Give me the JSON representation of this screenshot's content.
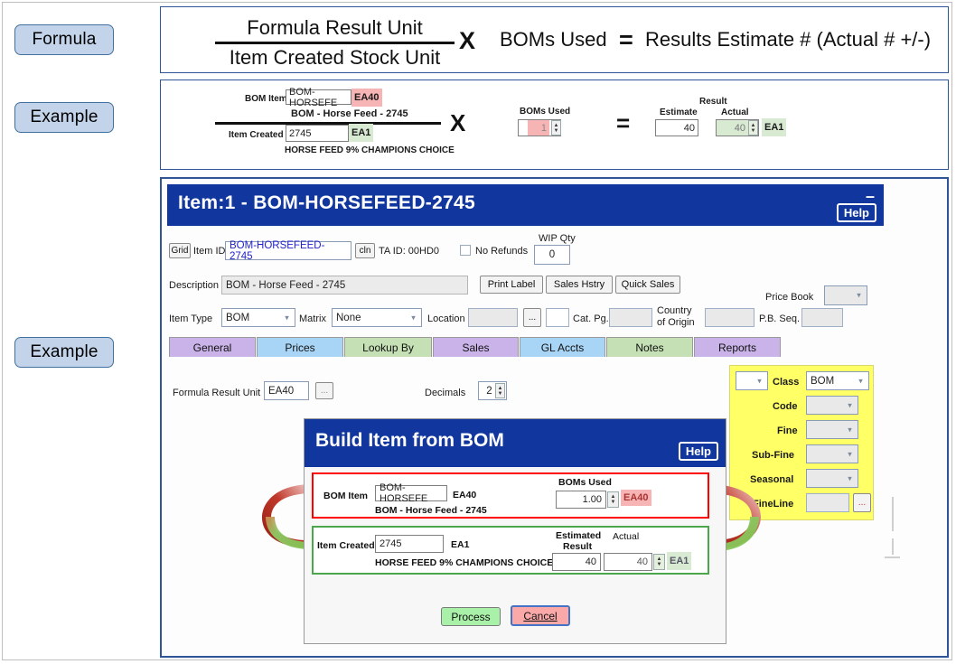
{
  "labels": {
    "formula": "Formula",
    "example_top": "Example",
    "example_bottom": "Example"
  },
  "formula": {
    "numerator": "Formula Result Unit",
    "denominator": "Item Created Stock Unit",
    "multiply_symbol": "X",
    "factor": "BOMs Used",
    "equals_symbol": "=",
    "result": "Results Estimate # (Actual # +/-)"
  },
  "example": {
    "bom_item_label": "BOM Item",
    "bom_item_value": "BOM-HORSEFE",
    "bom_item_unit": "EA40",
    "bom_description": "BOM - Horse Feed - 2745",
    "item_created_label": "Item Created",
    "item_created_value": "2745",
    "item_created_unit": "EA1",
    "item_description": "HORSE FEED 9% CHAMPIONS CHOICE",
    "multiply_symbol": "X",
    "boms_used_label": "BOMs Used",
    "boms_used_value": "1",
    "equals_symbol": "=",
    "result_label": "Result",
    "estimate_label": "Estimate",
    "estimate_value": "40",
    "actual_label": "Actual",
    "actual_value": "40",
    "actual_unit": "EA1"
  },
  "app": {
    "title": "Item:1 - BOM-HORSEFEED-2745",
    "minimize": "–",
    "help": "Help",
    "grid_button": "Grid",
    "item_id_label": "Item ID",
    "item_id_value": "BOM-HORSEFEED-2745",
    "cln_button": "cln",
    "ta_id": "TA ID: 00HD0",
    "no_refunds_label": "No Refunds",
    "wip_qty_label": "WIP Qty",
    "wip_qty_value": "0",
    "description_label": "Description",
    "description_value": "BOM - Horse Feed - 2745",
    "print_label_button": "Print Label",
    "sales_hstry_button": "Sales Hstry",
    "quick_sales_button": "Quick Sales",
    "price_book_label": "Price Book",
    "item_type_label": "Item Type",
    "item_type_value": "BOM",
    "matrix_label": "Matrix",
    "matrix_value": "None",
    "location_label": "Location",
    "ellipsis_button": "...",
    "cat_pg_label": "Cat. Pg.",
    "country_of_origin_label_1": "Country",
    "country_of_origin_label_2": "of Origin",
    "pb_seq_label": "P.B. Seq.",
    "tabs": [
      {
        "label": "General",
        "color": "purple"
      },
      {
        "label": "Prices",
        "color": "blue"
      },
      {
        "label": "Lookup By",
        "color": "green"
      },
      {
        "label": "Sales",
        "color": "purple"
      },
      {
        "label": "GL Accts",
        "color": "blue"
      },
      {
        "label": "Notes",
        "color": "green"
      },
      {
        "label": "Reports",
        "color": "purple"
      }
    ],
    "formula_result_unit_label": "Formula Result Unit",
    "formula_result_unit_value": "EA40",
    "formula_ellipsis": "...",
    "decimals_label": "Decimals",
    "decimals_value": "2"
  },
  "classpanel": {
    "class_label": "Class",
    "class_value": "BOM",
    "code_label": "Code",
    "fine_label": "Fine",
    "subfine_label": "Sub-Fine",
    "seasonal_label": "Seasonal",
    "fineline_label": "FineLine",
    "fineline_ellipsis": "...",
    "background": "#ffff66"
  },
  "dialog": {
    "title": "Build Item from BOM",
    "help": "Help",
    "bom_item_label": "BOM Item",
    "bom_item_value": "BOM-HORSEFE",
    "bom_item_unit": "EA40",
    "bom_description": "BOM - Horse Feed - 2745",
    "boms_used_label": "BOMs Used",
    "boms_used_value": "1.00",
    "boms_used_unit": "EA40",
    "item_created_label": "Item Created",
    "item_created_value": "2745",
    "item_created_unit": "EA1",
    "item_description": "HORSE FEED 9% CHAMPIONS CHOICE",
    "estimated_result_label_1": "Estimated",
    "estimated_result_label_2": "Result",
    "estimated_result_value": "40",
    "actual_label": "Actual",
    "actual_value": "40",
    "actual_unit": "EA1",
    "process_button": "Process",
    "cancel_button": "Cancel",
    "red_border_color": "#ff0000",
    "green_border_color": "#4ca64c"
  },
  "theme": {
    "title_blue": "#11379f",
    "pill_fill": "#c3d3ea",
    "pill_border": "#41719c",
    "highlight_red": "#f7b4b4",
    "highlight_green": "#d9ead3",
    "yellow": "#ffff66"
  }
}
